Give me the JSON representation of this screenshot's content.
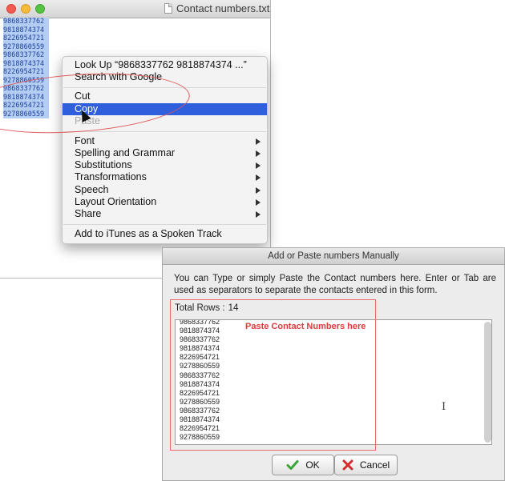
{
  "editor": {
    "title": "Contact numbers.txt",
    "numbers": [
      "9868337762",
      "9818874374",
      "8226954721",
      "9278860559",
      "9868337762",
      "9818874374",
      "8226954721",
      "9278860559",
      "9868337762",
      "9818874374",
      "8226954721",
      "9278860559"
    ]
  },
  "context_menu": {
    "look_up": "Look Up “9868337762  9818874374  ...”",
    "search_google": "Search with Google",
    "cut": "Cut",
    "copy": "Copy",
    "paste": "Paste",
    "font": "Font",
    "spelling": "Spelling and Grammar",
    "substitutions": "Substitutions",
    "transformations": "Transformations",
    "speech": "Speech",
    "layout_orientation": "Layout Orientation",
    "share": "Share",
    "add_itunes": "Add to iTunes as a Spoken Track"
  },
  "dialog": {
    "title": "Add or Paste numbers Manually",
    "description": "You can Type or simply Paste the Contact numbers here. Enter or Tab are used as separators to separate the contacts entered in this form.",
    "total_rows_label": "Total Rows :",
    "total_rows_value": "14",
    "paste_hint": "Paste Contact Numbers here",
    "numbers": [
      "9868337762",
      "9818874374",
      "9868337762",
      "9818874374",
      "8226954721",
      "9278860559",
      "9868337762",
      "9818874374",
      "8226954721",
      "9278860559",
      "9868337762",
      "9818874374",
      "8226954721",
      "9278860559"
    ],
    "ok_label": "OK",
    "cancel_label": "Cancel"
  },
  "colors": {
    "selection": "#b4cdf2",
    "menu_highlight": "#2f5fdc",
    "annotation_red": "#e05a5a"
  },
  "icons": {
    "ok": "green-check-icon",
    "cancel": "red-x-icon"
  }
}
